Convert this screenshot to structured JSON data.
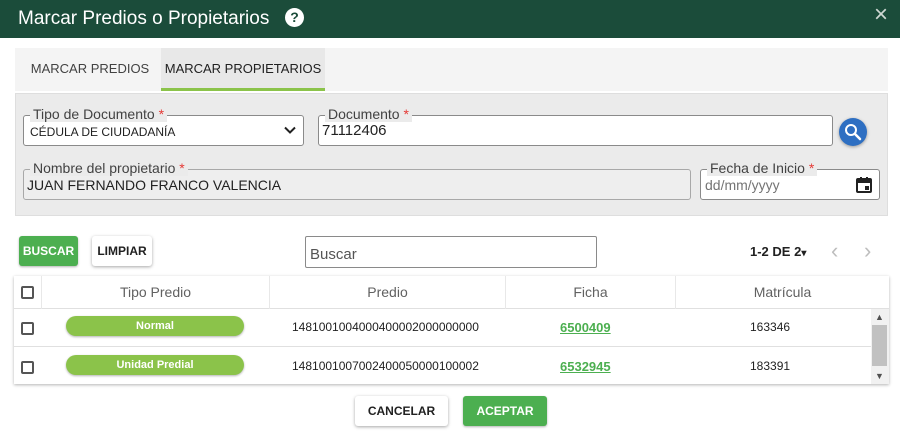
{
  "dialog": {
    "title": "Marcar Predios o Propietarios",
    "help_icon": "?",
    "close_icon": "×"
  },
  "tabs": [
    {
      "label": "MARCAR PREDIOS",
      "active": false
    },
    {
      "label": "MARCAR PROPIETARIOS",
      "active": true
    }
  ],
  "form": {
    "tipo_documento": {
      "label": "Tipo de Documento",
      "required_mark": "*",
      "value": "CÉDULA DE CIUDADANÍA"
    },
    "documento": {
      "label": "Documento",
      "required_mark": "*",
      "value": "71112406"
    },
    "nombre": {
      "label": "Nombre del propietario",
      "required_mark": "*",
      "value": "JUAN FERNANDO FRANCO VALENCIA"
    },
    "fecha_inicio": {
      "label": "Fecha de Inicio",
      "required_mark": "*",
      "placeholder": "dd/mm/yyyy"
    }
  },
  "actions": {
    "buscar": "BUSCAR",
    "limpiar": "LIMPIAR"
  },
  "search": {
    "placeholder": "Buscar"
  },
  "pagination": {
    "label": "1-2 DE 2",
    "caret": "▾",
    "prev": "‹",
    "next": "›"
  },
  "table": {
    "columns": [
      "Tipo Predio",
      "Predio",
      "Ficha",
      "Matrícula"
    ],
    "rows": [
      {
        "tipo": "Normal",
        "predio": "1481001004000400002000000000",
        "ficha": "6500409",
        "matricula": "163346"
      },
      {
        "tipo": "Unidad Predial",
        "predio": "1481001007002400050000100002",
        "ficha": "6532945",
        "matricula": "183391"
      }
    ]
  },
  "footer": {
    "cancelar": "CANCELAR",
    "aceptar": "ACEPTAR"
  },
  "colors": {
    "titlebar": "#1b4c3a",
    "accent_green": "#4caf50",
    "pill_green": "#8bc34a",
    "search_fab": "#2e6fc2",
    "required": "#e53935"
  }
}
